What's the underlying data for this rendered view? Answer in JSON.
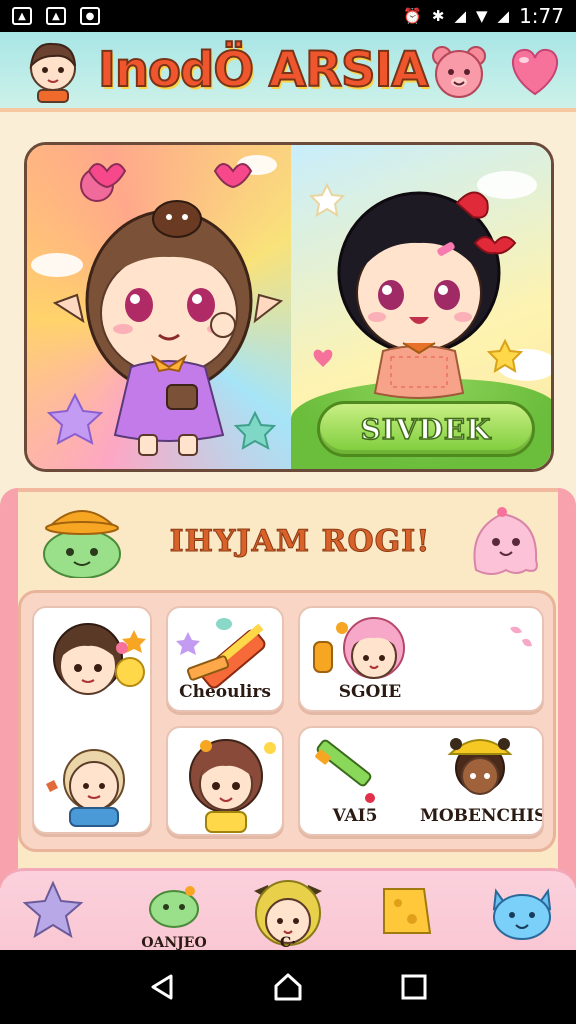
{
  "status_bar": {
    "time": "1:77",
    "left_icons": [
      "image-icon",
      "image-icon",
      "shield-icon"
    ],
    "right_icons": [
      "alarm-icon",
      "bluetooth-icon",
      "signal-icon",
      "wifi-icon",
      "signal-icon"
    ]
  },
  "header": {
    "title": "InodÖ ARSIA",
    "left_avatar": "player-avatar-icon",
    "buttons": [
      {
        "name": "bear-icon"
      },
      {
        "name": "heart-icon"
      }
    ]
  },
  "hero": {
    "start_label": "SIVDEK"
  },
  "collection": {
    "title": "IHYJAM ROGI!",
    "cards": [
      {
        "id": "chibi-girl-bear",
        "label": ""
      },
      {
        "id": "crayons",
        "label": "Cheoulirs"
      },
      {
        "id": "pink-hair",
        "label": "SGOIE"
      },
      {
        "id": "blonde-boy",
        "label": ""
      },
      {
        "id": "brown-hair-girl",
        "label": ""
      },
      {
        "id": "paint-tubes",
        "label": "VAI5"
      },
      {
        "id": "hat-kid",
        "label": "MOBENCHIS"
      }
    ]
  },
  "tabs": [
    {
      "name": "star",
      "label": ""
    },
    {
      "name": "slime",
      "label": "OANJEO"
    },
    {
      "name": "character",
      "label": "C·"
    },
    {
      "name": "cheese",
      "label": ""
    },
    {
      "name": "cat",
      "label": ""
    }
  ],
  "colors": {
    "title_orange": "#f0562e",
    "start_green": "#7ccc3a",
    "panel_bg": "#fbe9c6",
    "tab_pink": "#f9c7d3"
  }
}
